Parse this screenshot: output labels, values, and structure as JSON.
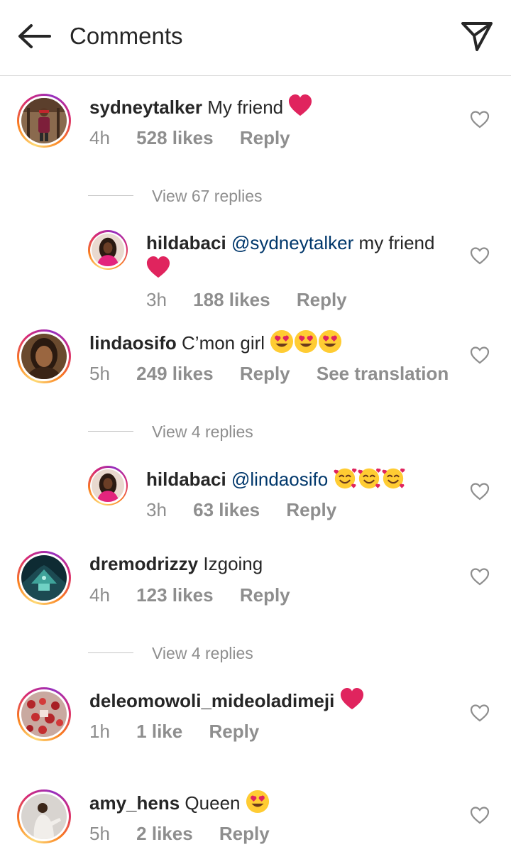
{
  "header": {
    "title": "Comments",
    "back_icon": "arrow-left-icon",
    "send_icon": "paper-plane-icon"
  },
  "comments": [
    {
      "user": "sydneytalker",
      "text": "My friend",
      "emoji": "red-heart",
      "time": "4h",
      "likes": "528 likes",
      "reply": "Reply"
    },
    {
      "view_replies": "View 67 replies"
    },
    {
      "user": "hildabaci",
      "mention": "@sydneytalker",
      "text": "my friend",
      "emoji": "red-heart",
      "time": "3h",
      "likes": "188 likes",
      "reply": "Reply"
    },
    {
      "user": "lindaosifo",
      "text": "C’mon girl",
      "emoji": "heart-eyes x3",
      "time": "5h",
      "likes": "249 likes",
      "reply": "Reply",
      "translate": "See translation"
    },
    {
      "view_replies": "View 4 replies"
    },
    {
      "user": "hildabaci",
      "mention": "@lindaosifo",
      "text": "",
      "emoji": "smiling-face-with-hearts x3",
      "time": "3h",
      "likes": "63 likes",
      "reply": "Reply"
    },
    {
      "user": "dremodrizzy",
      "text": "Izgoing",
      "time": "4h",
      "likes": "123 likes",
      "reply": "Reply"
    },
    {
      "view_replies": "View 4 replies"
    },
    {
      "user": "deleomowoli_mideoladimeji",
      "text": "",
      "emoji": "red-heart",
      "time": "1h",
      "likes": "1 like",
      "reply": "Reply"
    },
    {
      "user": "amy_hens",
      "text": "Queen",
      "emoji": "heart-eyes",
      "time": "5h",
      "likes": "2 likes",
      "reply": "Reply"
    }
  ],
  "colors": {
    "text": "#262626",
    "muted": "#8e8e8e",
    "mention": "#00376b",
    "divider": "#dbdbdb",
    "heart_emoji": "#e0245e"
  }
}
